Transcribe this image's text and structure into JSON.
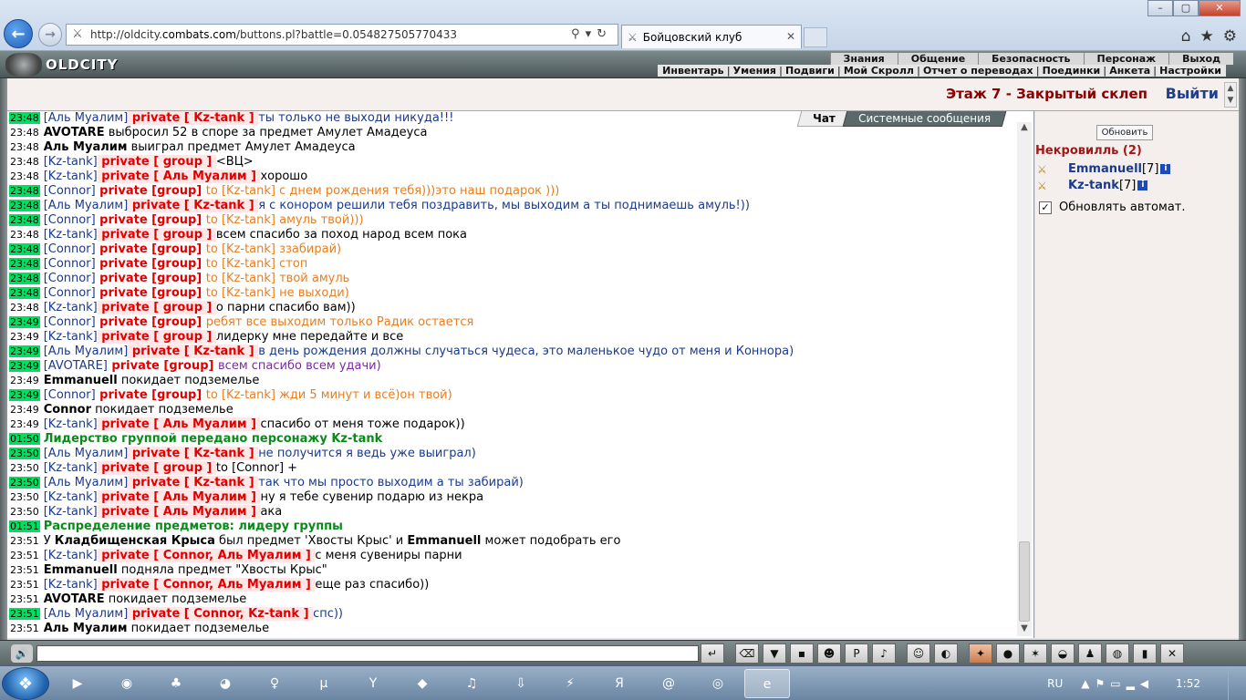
{
  "browser": {
    "url_prefix": "http://oldcity.",
    "url_domain": "combats.com",
    "url_rest": "/buttons.pl?battle=0.054827505770433",
    "tab_title": "Бойцовский клуб"
  },
  "header": {
    "logo": "OLDCITY",
    "menu": [
      "Знания",
      "Общение",
      "Безопасность",
      "Персонаж",
      "Выход"
    ],
    "submenu": [
      "Инвентарь",
      "Умения",
      "Подвиги",
      "Мой Скролл",
      "Отчет о переводах",
      "Поединки",
      "Анкета",
      "Настройки"
    ]
  },
  "location": {
    "title": "Этаж 7 - Закрытый склеп",
    "exit": "Выйти"
  },
  "chat_tabs": {
    "chat": "Чат",
    "system": "Системные сообщения"
  },
  "chat": [
    {
      "t": "23:48",
      "g": true,
      "parts": [
        [
          "br",
          "[Аль Муалим]"
        ],
        [
          "priv",
          " private [ Kz-tank ] "
        ],
        [
          "blue",
          "ты только не выходи никуда!!!"
        ]
      ]
    },
    {
      "t": "23:48",
      "g": false,
      "parts": [
        [
          "bold",
          "AVOTARE"
        ],
        [
          "black",
          " выбросил 52 в споре за предмет Амулет Амадеуса"
        ]
      ]
    },
    {
      "t": "23:48",
      "g": false,
      "parts": [
        [
          "bold",
          "Аль Муалим"
        ],
        [
          "black",
          " выиграл предмет Амулет Амадеуса"
        ]
      ]
    },
    {
      "t": "23:48",
      "g": false,
      "parts": [
        [
          "br",
          "[Kz-tank]"
        ],
        [
          "priv",
          " private [ group ] "
        ],
        [
          "black",
          "<ВЦ>"
        ]
      ]
    },
    {
      "t": "23:48",
      "g": false,
      "parts": [
        [
          "br",
          "[Kz-tank]"
        ],
        [
          "priv",
          " private [ Аль Муалим ] "
        ],
        [
          "black",
          "хорошо"
        ]
      ]
    },
    {
      "t": "23:48",
      "g": true,
      "parts": [
        [
          "br",
          "[Connor]"
        ],
        [
          "privg",
          " private [group] "
        ],
        [
          "orange",
          "to [Kz-tank] с днем рождения тебя)))это наш подарок )))"
        ]
      ]
    },
    {
      "t": "23:48",
      "g": true,
      "parts": [
        [
          "br",
          "[Аль Муалим]"
        ],
        [
          "priv",
          " private [ Kz-tank ] "
        ],
        [
          "blue",
          "я с конором решили тебя поздравить, мы выходим а ты поднимаешь амуль!))"
        ]
      ]
    },
    {
      "t": "23:48",
      "g": true,
      "parts": [
        [
          "br",
          "[Connor]"
        ],
        [
          "privg",
          " private [group] "
        ],
        [
          "orange",
          "to [Kz-tank] амуль твой)))"
        ]
      ]
    },
    {
      "t": "23:48",
      "g": false,
      "parts": [
        [
          "br",
          "[Kz-tank]"
        ],
        [
          "priv",
          " private [ group ] "
        ],
        [
          "black",
          "всем спасибо за поход народ всем пока"
        ]
      ]
    },
    {
      "t": "23:48",
      "g": true,
      "parts": [
        [
          "br",
          "[Connor]"
        ],
        [
          "privg",
          " private [group] "
        ],
        [
          "orange",
          "to [Kz-tank] ззабирай)"
        ]
      ]
    },
    {
      "t": "23:48",
      "g": true,
      "parts": [
        [
          "br",
          "[Connor]"
        ],
        [
          "privg",
          " private [group] "
        ],
        [
          "orange",
          "to [Kz-tank] стоп"
        ]
      ]
    },
    {
      "t": "23:48",
      "g": true,
      "parts": [
        [
          "br",
          "[Connor]"
        ],
        [
          "privg",
          " private [group] "
        ],
        [
          "orange",
          "to [Kz-tank] твой амуль"
        ]
      ]
    },
    {
      "t": "23:48",
      "g": true,
      "parts": [
        [
          "br",
          "[Connor]"
        ],
        [
          "privg",
          " private [group] "
        ],
        [
          "orange",
          "to [Kz-tank] не выходи)"
        ]
      ]
    },
    {
      "t": "23:48",
      "g": false,
      "parts": [
        [
          "br",
          "[Kz-tank]"
        ],
        [
          "priv",
          " private [ group ] "
        ],
        [
          "black",
          "о парни спасибо вам))"
        ]
      ]
    },
    {
      "t": "23:49",
      "g": true,
      "parts": [
        [
          "br",
          "[Connor]"
        ],
        [
          "privg",
          " private [group] "
        ],
        [
          "orange",
          "ребят все выходим только Радик остается"
        ]
      ]
    },
    {
      "t": "23:49",
      "g": false,
      "parts": [
        [
          "br",
          "[Kz-tank]"
        ],
        [
          "priv",
          " private [ group ] "
        ],
        [
          "black",
          "лидерку мне передайте и все"
        ]
      ]
    },
    {
      "t": "23:49",
      "g": true,
      "parts": [
        [
          "br",
          "[Аль Муалим]"
        ],
        [
          "priv",
          " private [ Kz-tank ] "
        ],
        [
          "blue",
          "в день рождения должны случаться чудеса, это маленькое чудо от меня и Коннора)"
        ]
      ]
    },
    {
      "t": "23:49",
      "g": true,
      "parts": [
        [
          "br",
          "[AVOTARE]"
        ],
        [
          "privg",
          " private [group] "
        ],
        [
          "purple",
          "всем спасибо всем удачи)"
        ]
      ]
    },
    {
      "t": "23:49",
      "g": false,
      "parts": [
        [
          "bold",
          "Emmanuell"
        ],
        [
          "black",
          " покидает подземелье"
        ]
      ]
    },
    {
      "t": "23:49",
      "g": true,
      "parts": [
        [
          "br",
          "[Connor]"
        ],
        [
          "privg",
          " private [group] "
        ],
        [
          "orange",
          "to [Kz-tank] жди 5 минут и всё)он твой)"
        ]
      ]
    },
    {
      "t": "23:49",
      "g": false,
      "parts": [
        [
          "bold",
          "Connor"
        ],
        [
          "black",
          " покидает подземелье"
        ]
      ]
    },
    {
      "t": "23:49",
      "g": false,
      "parts": [
        [
          "br",
          "[Kz-tank]"
        ],
        [
          "priv",
          " private [ Аль Муалим ] "
        ],
        [
          "black",
          "спасибо от меня тоже подарок))"
        ]
      ]
    },
    {
      "t": "01:50",
      "g": true,
      "parts": [
        [
          "green",
          "Лидерство группой передано персонажу Kz-tank"
        ]
      ]
    },
    {
      "t": "23:50",
      "g": true,
      "parts": [
        [
          "br",
          "[Аль Муалим]"
        ],
        [
          "priv",
          " private [ Kz-tank ] "
        ],
        [
          "blue",
          "не получится я ведь уже выиграл)"
        ]
      ]
    },
    {
      "t": "23:50",
      "g": false,
      "parts": [
        [
          "br",
          "[Kz-tank]"
        ],
        [
          "priv",
          " private [ group ] "
        ],
        [
          "black",
          "to [Connor] +"
        ]
      ]
    },
    {
      "t": "23:50",
      "g": true,
      "parts": [
        [
          "br",
          "[Аль Муалим]"
        ],
        [
          "priv",
          " private [ Kz-tank ] "
        ],
        [
          "blue",
          "так что мы просто выходим а ты забирай)"
        ]
      ]
    },
    {
      "t": "23:50",
      "g": false,
      "parts": [
        [
          "br",
          "[Kz-tank]"
        ],
        [
          "priv",
          " private [ Аль Муалим ] "
        ],
        [
          "black",
          "ну я тебе сувенир подарю из некра"
        ]
      ]
    },
    {
      "t": "23:50",
      "g": false,
      "parts": [
        [
          "br",
          "[Kz-tank]"
        ],
        [
          "priv",
          " private [ Аль Муалим ] "
        ],
        [
          "black",
          "ака"
        ]
      ]
    },
    {
      "t": "01:51",
      "g": true,
      "parts": [
        [
          "green",
          "Распределение предметов: лидеру группы"
        ]
      ]
    },
    {
      "t": "23:51",
      "g": false,
      "parts": [
        [
          "black",
          "У "
        ],
        [
          "bold",
          "Кладбищенская Крыса"
        ],
        [
          "black",
          " был предмет 'Хвосты Крыс' и "
        ],
        [
          "bold",
          "Emmanuell"
        ],
        [
          "black",
          " может подобрать его"
        ]
      ]
    },
    {
      "t": "23:51",
      "g": false,
      "parts": [
        [
          "br",
          "[Kz-tank]"
        ],
        [
          "priv",
          " private [ Connor, Аль Муалим ] "
        ],
        [
          "black",
          "с меня сувениры парни"
        ]
      ]
    },
    {
      "t": "23:51",
      "g": false,
      "parts": [
        [
          "bold",
          "Emmanuell"
        ],
        [
          "black",
          " подняла предмет \"Хвосты Крыс\""
        ]
      ]
    },
    {
      "t": "23:51",
      "g": false,
      "parts": [
        [
          "br",
          "[Kz-tank]"
        ],
        [
          "priv",
          " private [ Connor, Аль Муалим ] "
        ],
        [
          "black",
          "еще раз спасибо))"
        ]
      ]
    },
    {
      "t": "23:51",
      "g": false,
      "parts": [
        [
          "bold",
          "AVOTARE"
        ],
        [
          "black",
          " покидает подземелье"
        ]
      ]
    },
    {
      "t": "23:51",
      "g": true,
      "parts": [
        [
          "br",
          "[Аль Муалим]"
        ],
        [
          "priv",
          " private [ Connor, Kz-tank ] "
        ],
        [
          "blue",
          "спс))"
        ]
      ]
    },
    {
      "t": "23:51",
      "g": false,
      "parts": [
        [
          "bold",
          "Аль Муалим"
        ],
        [
          "black",
          " покидает подземелье"
        ]
      ]
    }
  ],
  "panel": {
    "refresh": "Обновить",
    "room": "Некровилль (2)",
    "players": [
      {
        "name": "Emmanuell",
        "level": "[7]"
      },
      {
        "name": "Kz-tank",
        "level": "[7]"
      }
    ],
    "auto_refresh": "Обновлять автомат."
  },
  "taskbar": {
    "lang": "RU",
    "clock": "1:52"
  }
}
